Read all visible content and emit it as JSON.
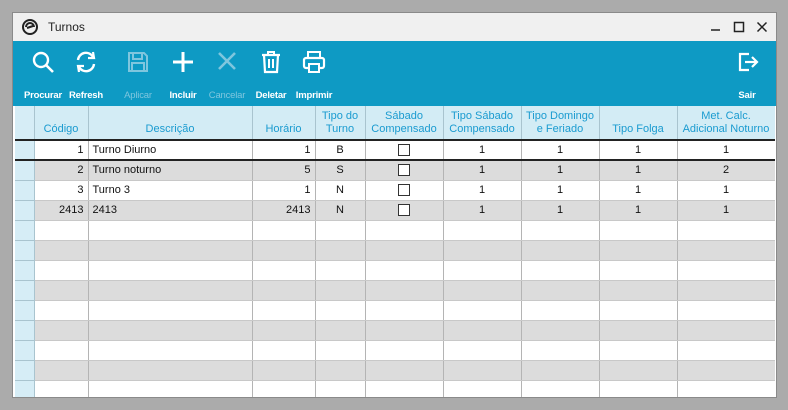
{
  "window": {
    "title": "Turnos"
  },
  "toolbar": {
    "procurar": "Procurar",
    "refresh": "Refresh",
    "aplicar": "Aplicar",
    "incluir": "Incluir",
    "cancelar": "Cancelar",
    "deletar": "Deletar",
    "imprimir": "Imprimir",
    "sair": "Sair"
  },
  "columns": {
    "codigo": "Código",
    "descricao": "Descrição",
    "horario": "Horário",
    "tipo_turno_1": "Tipo do",
    "tipo_turno_2": "Turno",
    "sabado_1": "Sábado",
    "sabado_2": "Compensado",
    "tipo_sabado_1": "Tipo Sábado",
    "tipo_sabado_2": "Compensado",
    "tipo_domingo_1": "Tipo Domingo",
    "tipo_domingo_2": "e Feriado",
    "tipo_folga": "Tipo Folga",
    "met_calc_1": "Met. Calc.",
    "met_calc_2": "Adicional Noturno"
  },
  "rows": [
    {
      "codigo": "1",
      "descricao": "Turno Diurno",
      "horario": "1",
      "tipo_turno": "B",
      "sabado_compensado": false,
      "tipo_sabado": "1",
      "tipo_domingo": "1",
      "tipo_folga": "1",
      "met_calc": "1"
    },
    {
      "codigo": "2",
      "descricao": "Turno noturno",
      "horario": "5",
      "tipo_turno": "S",
      "sabado_compensado": false,
      "tipo_sabado": "1",
      "tipo_domingo": "1",
      "tipo_folga": "1",
      "met_calc": "2"
    },
    {
      "codigo": "3",
      "descricao": "Turno 3",
      "horario": "1",
      "tipo_turno": "N",
      "sabado_compensado": false,
      "tipo_sabado": "1",
      "tipo_domingo": "1",
      "tipo_folga": "1",
      "met_calc": "1"
    },
    {
      "codigo": "2413",
      "descricao": "2413",
      "horario": "2413",
      "tipo_turno": "N",
      "sabado_compensado": false,
      "tipo_sabado": "1",
      "tipo_domingo": "1",
      "tipo_folga": "1",
      "met_calc": "1"
    }
  ],
  "colors": {
    "accent": "#0e9ac4",
    "header_bg": "#d3ecf5",
    "header_text": "#1a9bd0",
    "alt_row": "#dcdcdc"
  }
}
